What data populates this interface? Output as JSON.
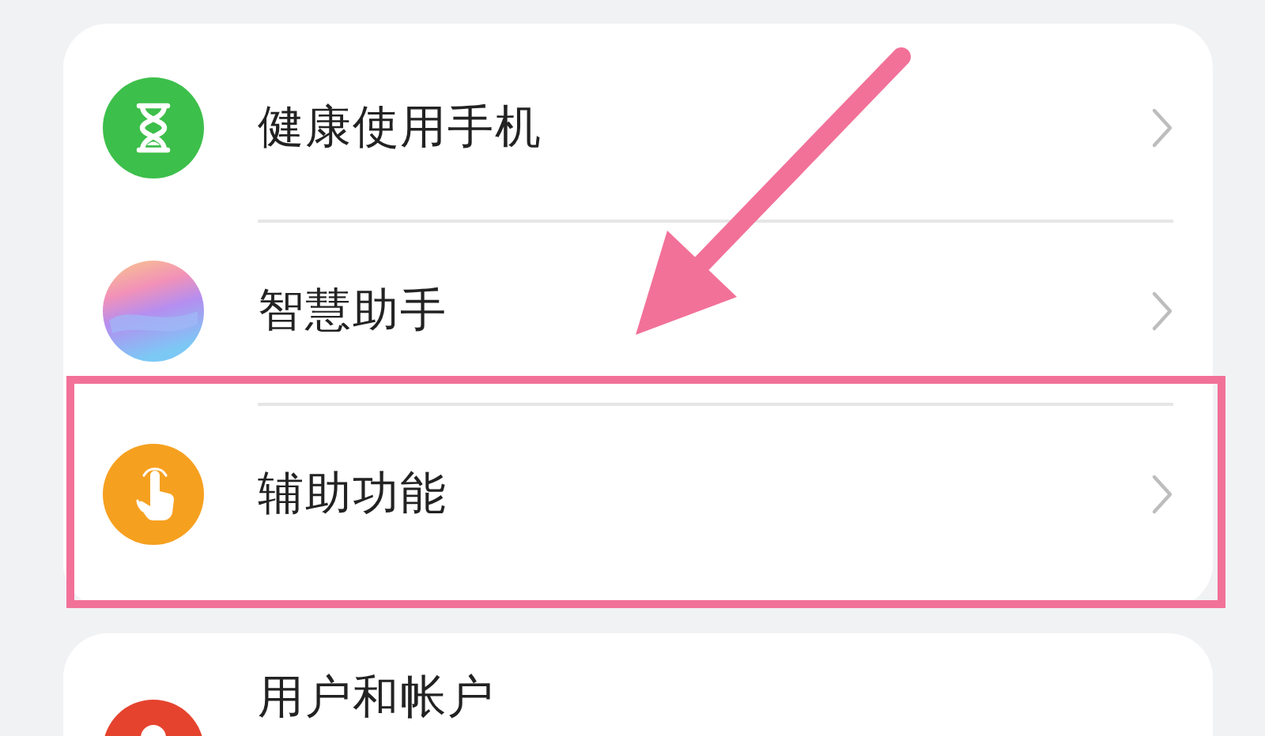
{
  "groups": [
    {
      "items": [
        {
          "label": "健康使用手机",
          "highlighted": false
        },
        {
          "label": "智慧助手",
          "highlighted": false
        },
        {
          "label": "辅助功能",
          "highlighted": true
        }
      ]
    },
    {
      "items": [
        {
          "label": "用户和帐户",
          "highlighted": false
        }
      ]
    }
  ]
}
